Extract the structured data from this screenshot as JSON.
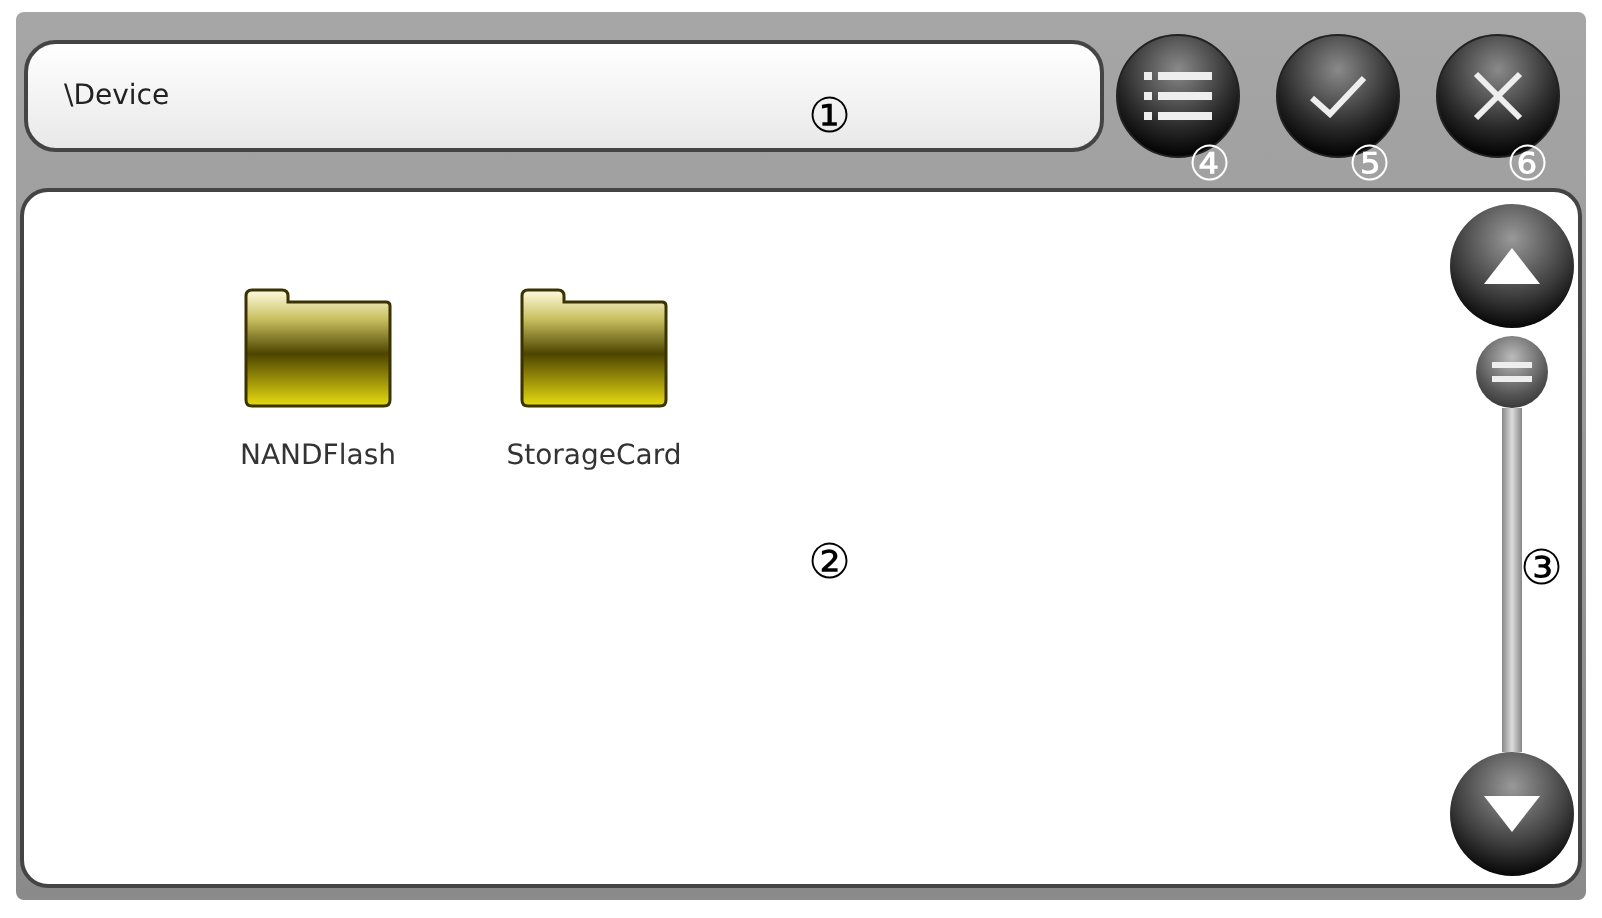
{
  "path_field": {
    "value": "\\Device"
  },
  "toolbar_buttons": [
    {
      "kind": "list"
    },
    {
      "kind": "check"
    },
    {
      "kind": "close"
    }
  ],
  "files": [
    {
      "name": "NANDFlash",
      "kind": "folder"
    },
    {
      "name": "StorageCard",
      "kind": "folder"
    }
  ],
  "callouts": [
    "①",
    "④",
    "⑤",
    "⑥",
    "②",
    "③"
  ]
}
